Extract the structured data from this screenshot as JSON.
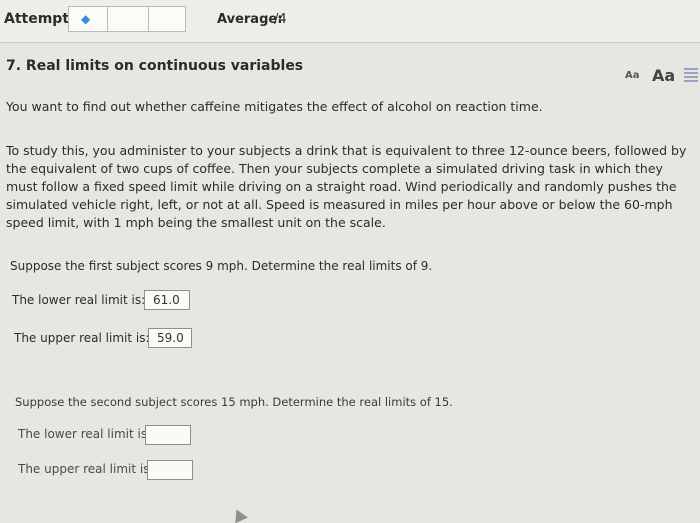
{
  "header": {
    "attempts_label": "Attempts:",
    "attempt_icon": "diamond-icon",
    "average_label": "Average:",
    "average_value": "/4"
  },
  "question": {
    "title": "7. Real limits on continuous variables",
    "font_small": "Aa",
    "font_large": "Aa",
    "intro": "You want to find out whether caffeine mitigates the effect of alcohol on reaction time.",
    "body": "To study this, you administer to your subjects a drink that is equivalent to three 12-ounce beers, followed by the equivalent of two cups of coffee. Then your subjects complete a simulated driving task in which they must follow a fixed speed limit while driving on a straight road. Wind periodically and randomly pushes the simulated vehicle right, left, or not at all. Speed is measured in miles per hour above or below the 60-mph speed limit, with 1 mph being the smallest unit on the scale."
  },
  "part1": {
    "prompt": "Suppose the first subject scores 9 mph. Determine the real limits of 9.",
    "lower_label": "The lower real limit is:",
    "lower_value": "61.0",
    "upper_label": "The upper real limit is:",
    "upper_value": "59.0"
  },
  "part2": {
    "prompt": "Suppose the second subject scores 15 mph. Determine the real limits of 15.",
    "lower_label": "The lower real limit is:",
    "lower_value": "",
    "upper_label": "The upper real limit is:",
    "upper_value": ""
  },
  "colors": {
    "background": "#e6e7e2",
    "accent_icon": "#3a8fd4"
  }
}
